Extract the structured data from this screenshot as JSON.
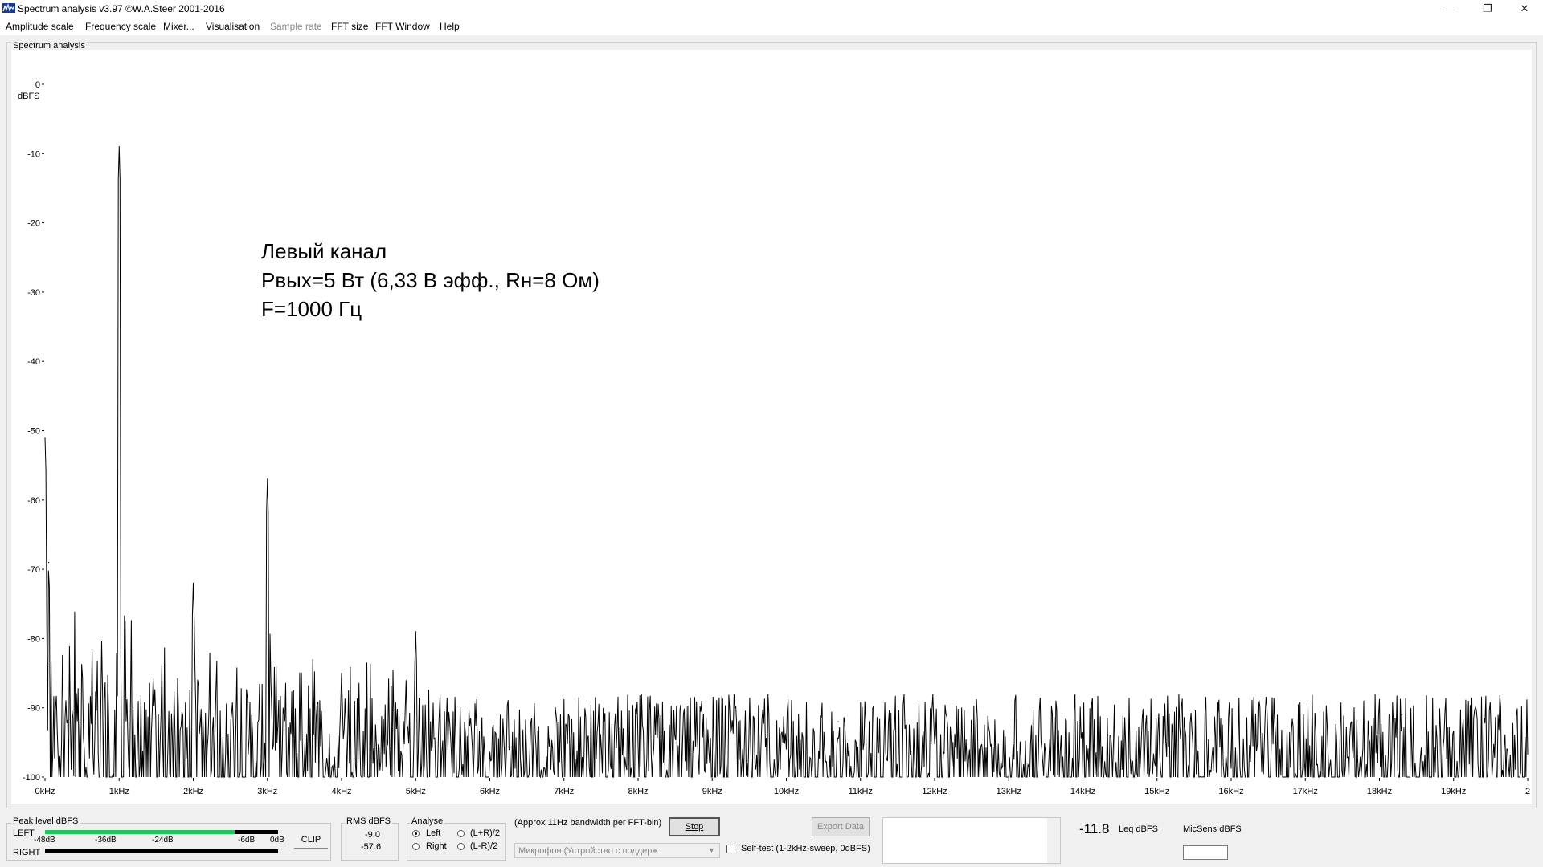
{
  "window": {
    "title": "Spectrum analysis v3.97  ©W.A.Steer 2001-2016",
    "minimize": "—",
    "maximize": "❐",
    "close": "✕"
  },
  "menu": [
    {
      "label": "Amplitude scale",
      "enabled": true
    },
    {
      "label": "Frequency scale",
      "enabled": true
    },
    {
      "label": "Mixer...",
      "enabled": true
    },
    {
      "label": "Visualisation",
      "enabled": true
    },
    {
      "label": "Sample rate",
      "enabled": false
    },
    {
      "label": "FFT size",
      "enabled": true
    },
    {
      "label": "FFT Window",
      "enabled": true
    },
    {
      "label": "Help",
      "enabled": true
    }
  ],
  "chart_group_title": "Spectrum analysis",
  "annotation": {
    "line1": "Левый канал",
    "line2": "Pвых=5 Вт (6,33 В эфф., Rн=8 Ом)",
    "line3": "F=1000 Гц"
  },
  "chart_data": {
    "type": "line",
    "ylabel": "dBFS",
    "ylim": [
      -100,
      0
    ],
    "xlim": [
      0,
      20
    ],
    "y_ticks": [
      "0",
      "-10",
      "-20",
      "-30",
      "-40",
      "-50",
      "-60",
      "-70",
      "-80",
      "-90",
      "-100"
    ],
    "x_ticks": [
      "0kHz",
      "1kHz",
      "2kHz",
      "3kHz",
      "4kHz",
      "5kHz",
      "6kHz",
      "7kHz",
      "8kHz",
      "9kHz",
      "10kHz",
      "11kHz",
      "12kHz",
      "13kHz",
      "14kHz",
      "15kHz",
      "16kHz",
      "17kHz",
      "18kHz",
      "19kHz",
      "2"
    ],
    "x_unit": "kHz",
    "peaks": [
      {
        "x": 0.0,
        "y": -51
      },
      {
        "x": 0.05,
        "y": -69
      },
      {
        "x": 1.0,
        "y": -9
      },
      {
        "x": 2.0,
        "y": -72
      },
      {
        "x": 3.0,
        "y": -57
      },
      {
        "x": 4.0,
        "y": -85
      },
      {
        "x": 5.0,
        "y": -79
      },
      {
        "x": 10.7,
        "y": -92
      },
      {
        "x": 18.3,
        "y": -91
      }
    ],
    "noise_floor": {
      "from": -100,
      "to": -91
    }
  },
  "bottom": {
    "peak_level": {
      "title": "Peak level dBFS",
      "left_label": "LEFT",
      "right_label": "RIGHT",
      "scale": [
        "-48dB",
        "-36dB",
        "-24dB",
        "-6dB",
        "0dB"
      ],
      "left_level_dbfs": -9,
      "clip_label": "CLIP",
      "bar_color": "#22c55e"
    },
    "rms": {
      "title": "RMS dBFS",
      "value1": "-9.0",
      "value2": "-57.6"
    },
    "analyse": {
      "title": "Analyse",
      "options": [
        {
          "label": "Left",
          "checked": true
        },
        {
          "label": "Right",
          "checked": false
        },
        {
          "label": "(L+R)/2",
          "checked": false
        },
        {
          "label": "(L-R)/2",
          "checked": false
        }
      ]
    },
    "bandwidth_note": "(Approx 11Hz bandwidth per FFT-bin)",
    "stop_label": "Stop",
    "device_select": "Микрофон (Устройство с поддерж",
    "export_label": "Export Data",
    "selftest_label": "Self-test  (1-2kHz-sweep, 0dBFS)",
    "leq_value": "-11.8",
    "leq_unit": "Leq dBFS",
    "micsens_label": "MicSens dBFS"
  }
}
